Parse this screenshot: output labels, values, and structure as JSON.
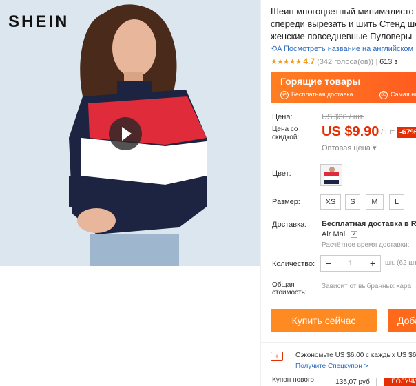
{
  "product_image": {
    "brand": "SHEIN"
  },
  "product": {
    "title_lines": [
      "Шеин многоцветный минималисто",
      "спереди вырезать и шить Стенд ше",
      "женские повседневные Пуловеры"
    ],
    "translate_link": "Посмотреть название на английском",
    "rating_value": "4.7",
    "votes": "(342 голоса(ов))",
    "sold": "613 з"
  },
  "hot_banner": {
    "title": "Горящие товары",
    "feature_1": "Бесплатная доставка",
    "feature_2": "Самая низкая"
  },
  "pricing": {
    "price_label": "Цена:",
    "old_price": "US $30 / шт.",
    "discount_label_1": "Цена со",
    "discount_label_2": "скидкой:",
    "price": "US $9.90",
    "unit": "/ шт.",
    "discount": "-67%",
    "wholesale": "Оптовая цена"
  },
  "options": {
    "color_label": "Цвет:",
    "size_label": "Размер:",
    "sizes": [
      "XS",
      "S",
      "M",
      "L"
    ]
  },
  "shipping": {
    "label": "Доставка:",
    "method": "Бесплатная доставка в Rus",
    "carrier": "Air Mail",
    "time": "Расчётное время доставки:"
  },
  "quantity": {
    "label": "Количество:",
    "value": "1",
    "available": "шт. (62 шт"
  },
  "total": {
    "label_1": "Общая",
    "label_2": "стоимость:",
    "value": "Зависит от выбранных хара"
  },
  "actions": {
    "buy_now": "Купить сейчас",
    "add_to_cart": "Доба"
  },
  "coupon": {
    "save_text": "Сэкономьте US $6.00 с каждых US $6",
    "link_text": "Получите Спецкупон >",
    "new_buyer_label": "Купон нового",
    "new_buyer_price": "135,07 руб",
    "get_label": "ПОЛУЧИ"
  },
  "colors": {
    "accent_orange": "#ff7f22",
    "price_red": "#e62e04",
    "link_blue": "#2b6bbf",
    "star": "#f29a1b"
  }
}
